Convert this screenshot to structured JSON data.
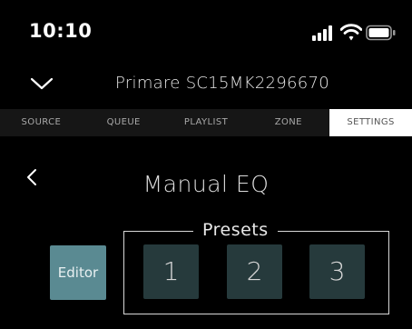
{
  "status_bar": {
    "time": "10:10",
    "icons": [
      "signal-icon",
      "wifi-icon",
      "battery-icon"
    ]
  },
  "header": {
    "collapse_icon": "chevron-down-icon",
    "device_name": "Primare SC15MK2296670"
  },
  "tabs": [
    {
      "label": "SOURCE",
      "active": false
    },
    {
      "label": "QUEUE",
      "active": false
    },
    {
      "label": "PLAYLIST",
      "active": false
    },
    {
      "label": "ZONE",
      "active": false
    },
    {
      "label": "SETTINGS",
      "active": true
    }
  ],
  "page": {
    "back_icon": "chevron-left-icon",
    "title": "Manual EQ"
  },
  "editor": {
    "label": "Editor"
  },
  "presets": {
    "label": "Presets",
    "items": [
      "1",
      "2",
      "3"
    ]
  },
  "colors": {
    "background": "#000000",
    "tab_bar": "#161616",
    "active_tab": "#ffffff",
    "editor_button": "#5a8a92",
    "preset_button": "#263a3c"
  }
}
